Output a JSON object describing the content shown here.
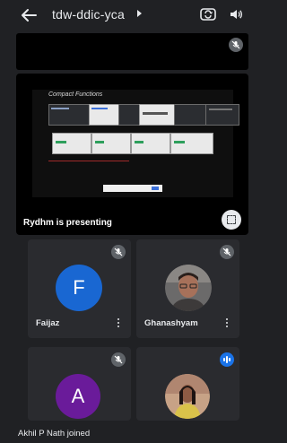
{
  "header": {
    "meeting_code": "tdw-ddic-yca",
    "back_icon": "arrow-left-icon",
    "switch_camera_icon": "camera-switch-icon",
    "audio_icon": "speaker-icon"
  },
  "presentation": {
    "slide_title": "Compact Functions",
    "status": "Rydhm  is presenting"
  },
  "participants": [
    {
      "name": "Faijaz",
      "initial": "F",
      "avatar_color": "#1967d2",
      "muted": true
    },
    {
      "name": "Ghanashyam",
      "initial": "",
      "avatar_color": "#6b6a6a",
      "muted": true
    },
    {
      "name": "",
      "initial": "A",
      "avatar_color": "#6a1b9a",
      "muted": true
    },
    {
      "name": "",
      "initial": "",
      "avatar_color": "#b08670",
      "muted": false,
      "speaking": true
    }
  ],
  "toast": {
    "text": "Akhil P Nath joined"
  },
  "colors": {
    "background": "#202124",
    "tile": "#2a2b2f",
    "accent": "#1a73e8"
  }
}
